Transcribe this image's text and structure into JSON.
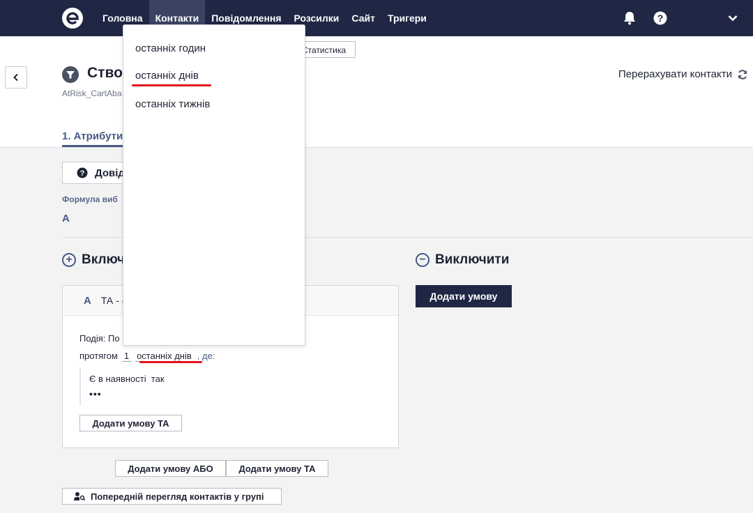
{
  "nav": {
    "items": [
      "Головна",
      "Контакти",
      "Повідомлення",
      "Розсилки",
      "Сайт",
      "Тригери"
    ],
    "active_index": 1
  },
  "header": {
    "stats_button": "Статистика",
    "title": "Створ",
    "subtitle": "AtRisk_CartAba",
    "recalc_label": "Перерахувати контакти"
  },
  "tabs": {
    "first": "1. Атрибути"
  },
  "help_button": "Довід",
  "formula": {
    "label": "Формула виб",
    "value": "A"
  },
  "include": {
    "title": "Включ"
  },
  "exclude": {
    "title": "Виключити",
    "add_button": "Додати умову"
  },
  "card": {
    "letter": "A",
    "head_text": "ТА - (",
    "event": "Подія: По",
    "period_prefix": "протягом",
    "period_num": "1",
    "period_unit": "останніх днів",
    "where": ", де:",
    "condition": "Є в наявності  так",
    "dots": "•••",
    "add_and": "Додати умову ТА"
  },
  "bottom": {
    "add_or": "Додати умову АБО",
    "add_and": "Додати умову ТА",
    "preview": "Попередній перегляд контактів у групі"
  },
  "dropdown": {
    "items": [
      "останніх годин",
      "останніх днів",
      "останніх тижнів"
    ]
  },
  "colors": {
    "nav_bg": "#1f2744",
    "accent": "#4a5a86",
    "highlight": "#e1131d"
  }
}
